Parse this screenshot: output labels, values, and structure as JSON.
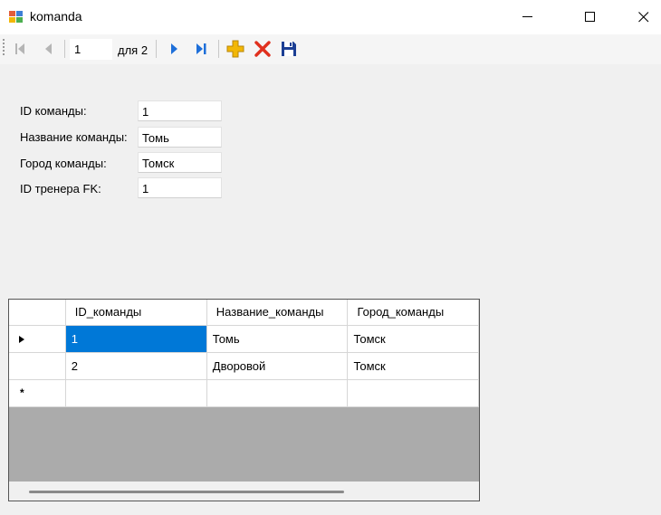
{
  "window": {
    "title": "komanda"
  },
  "navigator": {
    "position": "1",
    "count_text": "для 2",
    "buttons": [
      "move-first-icon",
      "move-previous-icon",
      "move-next-icon",
      "move-last-icon",
      "add-new-icon",
      "delete-icon",
      "save-icon"
    ]
  },
  "form": {
    "fields": [
      {
        "label": "ID команды:",
        "value": "1"
      },
      {
        "label": "Название команды:",
        "value": "Томь"
      },
      {
        "label": "Город команды:",
        "value": "Томск"
      },
      {
        "label": "ID тренера FK:",
        "value": "1"
      }
    ]
  },
  "grid": {
    "columns": [
      "ID_команды",
      "Название_команды",
      "Город_команды"
    ],
    "rows": [
      [
        "1",
        "Томь",
        "Томск"
      ],
      [
        "2",
        "Дворовой",
        "Томск"
      ]
    ],
    "new_row_marker": "*"
  },
  "colors": {
    "selection": "#0078d7",
    "nav_arrow_blue": "#1e6fd9",
    "add_yellow": "#f2b705",
    "delete_red": "#e0301e",
    "save_navy": "#1c3f94"
  }
}
